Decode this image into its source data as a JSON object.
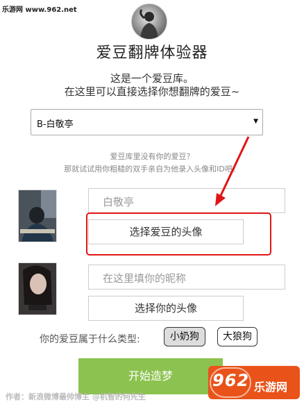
{
  "watermark_top": "乐游网 www.962.net",
  "title": "爱豆翻牌体验器",
  "intro": [
    "这是一个爱豆库。",
    "在这里可以直接选择你想翻牌的爱豆~"
  ],
  "idol_select": {
    "value": "B-白敬亭"
  },
  "hint": [
    "爱豆库里没有你的爱豆？",
    "那就试试用你粗糙的双手亲自为他录入头像和ID吧！"
  ],
  "idol_name_field": {
    "value": "白敬亭"
  },
  "choose_idol_avatar_button": "选择爱豆的头像",
  "your_nickname_field": {
    "placeholder": "在这里填你的昵称"
  },
  "choose_your_avatar_button": "选择你的头像",
  "type_question": "你的爱豆属于什么类型:",
  "type_options": [
    "小奶狗",
    "大狼狗"
  ],
  "type_selected": "小奶狗",
  "start_button": "开始造梦",
  "credit": "作者：新浪微博最帅博主 @机智的何先生",
  "site_badge": {
    "number": "962",
    "name": "乐游网"
  },
  "colors": {
    "start_button": "#8cc24f",
    "annotation_red": "#e01515",
    "badge": "#e9531a"
  }
}
